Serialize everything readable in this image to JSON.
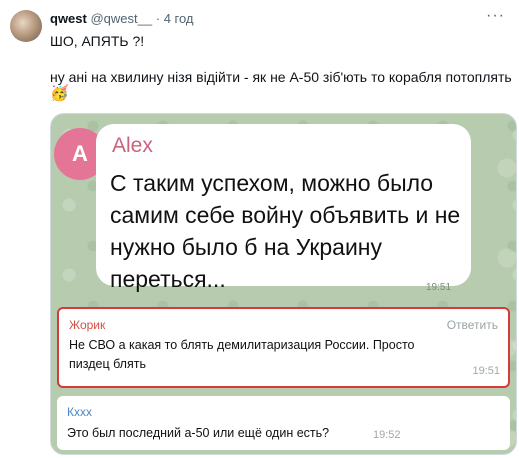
{
  "tweet": {
    "author_name": "qwest",
    "author_handle": "@qwest__",
    "separator": "·",
    "time": "4 год",
    "line1": "ШО, АПЯТЬ ?!",
    "line2": "ну ані на хвилину нізя відійти - як не А-50 зіб'ють  то корабля потоплять",
    "emoji": "🥳",
    "more_label": "···"
  },
  "screenshot": {
    "big_message": {
      "avatar_letter": "A",
      "sender": "Alex",
      "text": "С таким успехом, можно было самим себе войну объявить и не нужно было б на Украину переться...",
      "time": "19:51"
    },
    "messages": [
      {
        "sender": "Жорик",
        "reply_label": "Ответить",
        "text": "Не СВО а какая то блять демилитаризация России. Просто пиздец блять",
        "time": "19:51"
      },
      {
        "sender": "Кххх",
        "text": "Это был последний а-50 или ещё один есть?",
        "time": "19:52"
      }
    ]
  },
  "colors": {
    "alex_name": "#c9647f",
    "avatar_pink": "#e57597",
    "highlight_border": "#d83a3a",
    "zhorik_name": "#d24f43",
    "kxxx_name": "#4a86c8",
    "chat_background": "#b7ccae"
  }
}
